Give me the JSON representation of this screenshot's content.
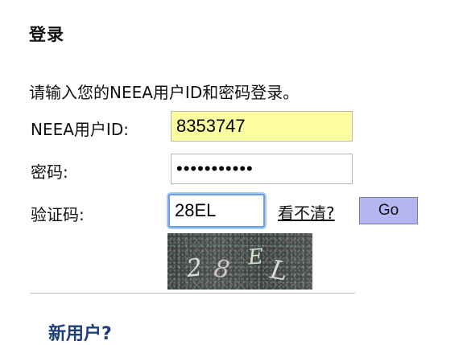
{
  "login": {
    "heading": "登录",
    "instruction": "请输入您的NEEA用户ID和密码登录。",
    "user_id_label": "NEEA用户ID:",
    "user_id_value": "8353747",
    "password_label": "密码:",
    "password_value": "•••••••••••",
    "captcha_label": "验证码:",
    "captcha_value": "28EL",
    "refresh_link": "看不清?",
    "go_button": "Go",
    "captcha_image_text": "28EL"
  },
  "new_user": {
    "heading": "新用户?"
  },
  "colors": {
    "user_id_field_bg": "#fbfda0",
    "go_button_bg": "#b5b5f2",
    "focus_ring": "#6f9ee0",
    "captcha_bg": "#3f4442",
    "new_user_heading": "#1c3f7a"
  },
  "icons": []
}
